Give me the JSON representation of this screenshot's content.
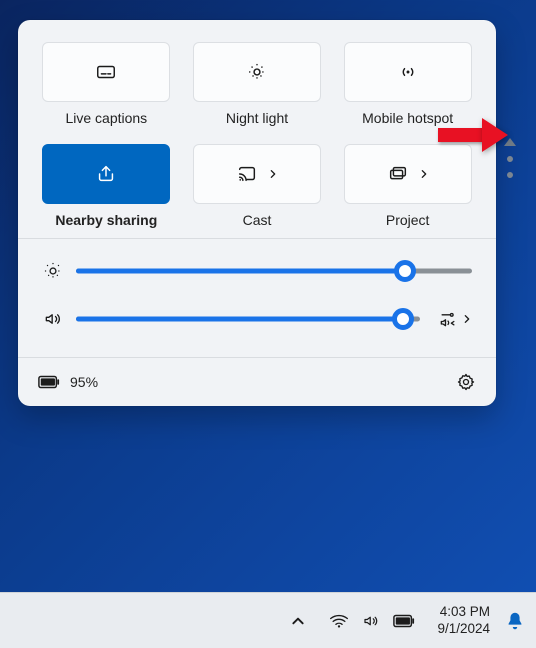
{
  "tiles": [
    {
      "id": "live-captions",
      "label": "Live captions",
      "icon": "captions-icon",
      "active": false,
      "has_submenu": false
    },
    {
      "id": "night-light",
      "label": "Night light",
      "icon": "night-light-icon",
      "active": false,
      "has_submenu": false
    },
    {
      "id": "mobile-hotspot",
      "label": "Mobile hotspot",
      "icon": "hotspot-icon",
      "active": false,
      "has_submenu": false
    },
    {
      "id": "nearby-sharing",
      "label": "Nearby sharing",
      "icon": "share-icon",
      "active": true,
      "has_submenu": false
    },
    {
      "id": "cast",
      "label": "Cast",
      "icon": "cast-icon",
      "active": false,
      "has_submenu": true
    },
    {
      "id": "project",
      "label": "Project",
      "icon": "project-icon",
      "active": false,
      "has_submenu": true
    }
  ],
  "sliders": {
    "brightness": {
      "value": 83
    },
    "volume": {
      "value": 95
    }
  },
  "footer": {
    "battery_text": "95%"
  },
  "taskbar": {
    "time": "4:03 PM",
    "date": "9/1/2024"
  },
  "annotation": {
    "arrow_color": "#e81123"
  }
}
